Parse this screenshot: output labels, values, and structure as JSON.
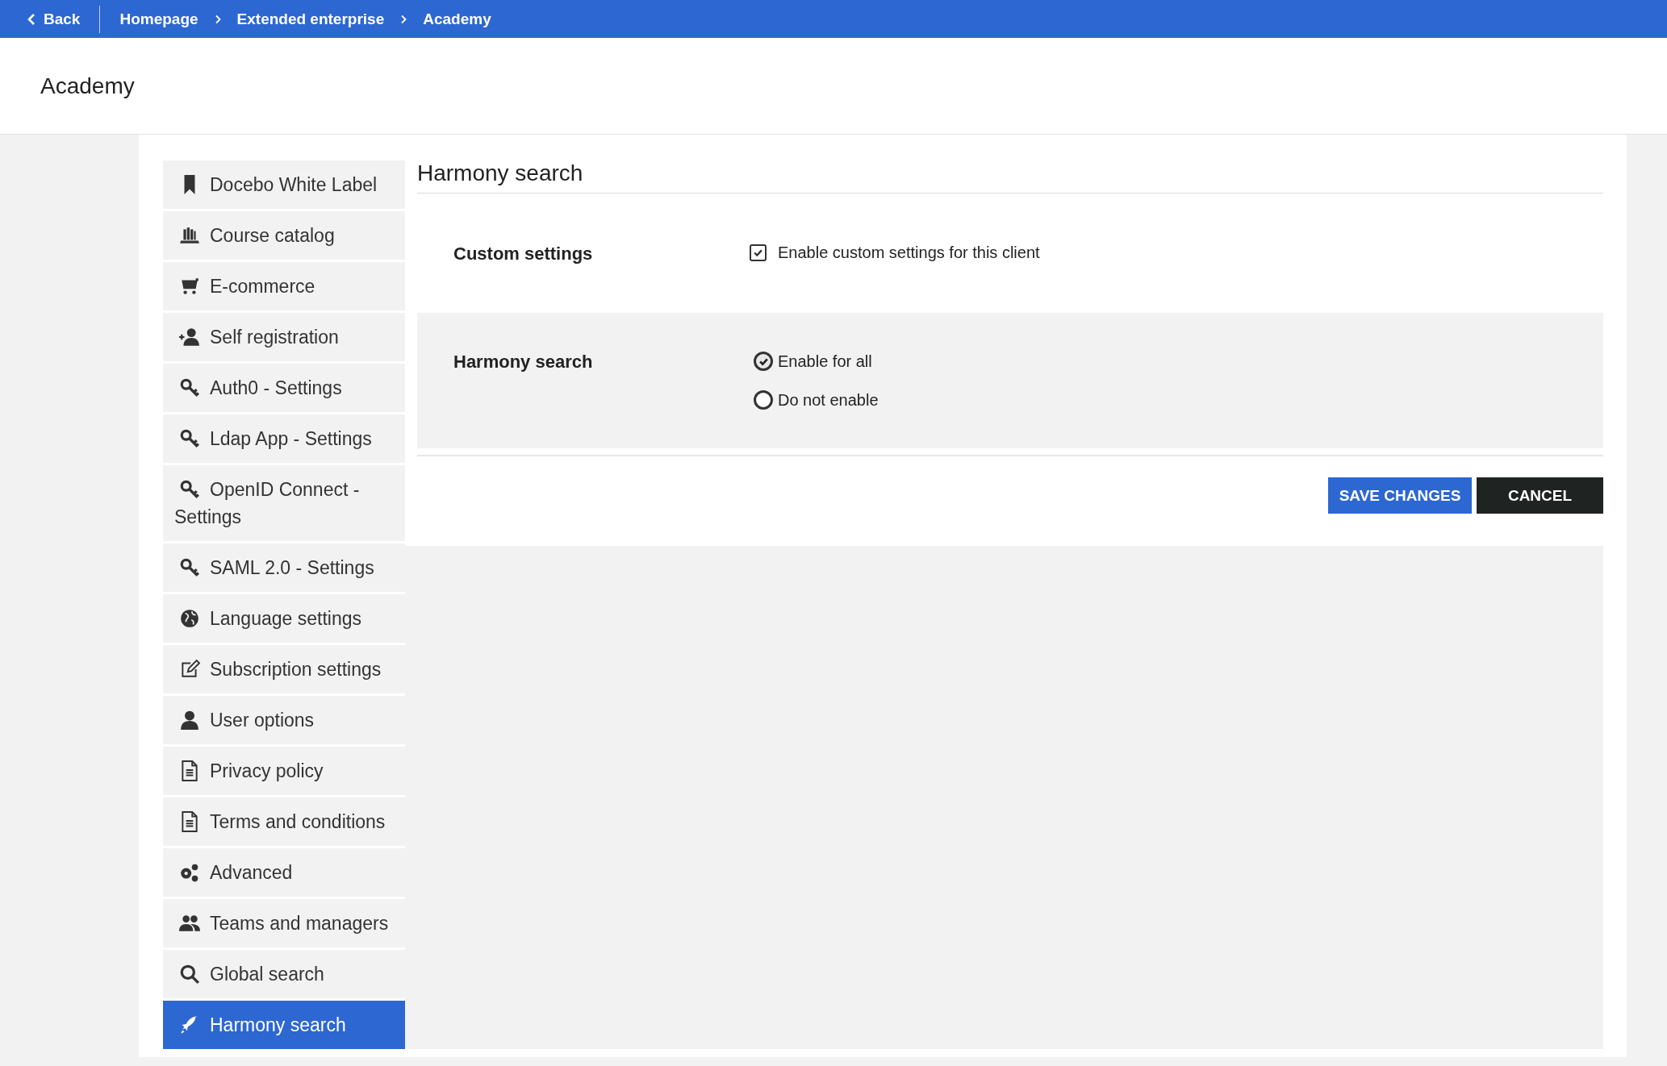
{
  "breadcrumb": {
    "back": "Back",
    "items": [
      "Homepage",
      "Extended enterprise",
      "Academy"
    ]
  },
  "page_title": "Academy",
  "sidebar": {
    "items": [
      {
        "label": "Docebo White Label",
        "selected": false
      },
      {
        "label": "Course catalog",
        "selected": false
      },
      {
        "label": "E-commerce",
        "selected": false
      },
      {
        "label": "Self registration",
        "selected": false
      },
      {
        "label": "Auth0 - Settings",
        "selected": false
      },
      {
        "label": "Ldap App - Settings",
        "selected": false
      },
      {
        "label": "OpenID Connect - Settings",
        "selected": false
      },
      {
        "label": "SAML 2.0 - Settings",
        "selected": false
      },
      {
        "label": "Language settings",
        "selected": false
      },
      {
        "label": "Subscription settings",
        "selected": false
      },
      {
        "label": "User options",
        "selected": false
      },
      {
        "label": "Privacy policy",
        "selected": false
      },
      {
        "label": "Terms and conditions",
        "selected": false
      },
      {
        "label": "Advanced",
        "selected": false
      },
      {
        "label": "Teams and managers",
        "selected": false
      },
      {
        "label": "Global search",
        "selected": false
      },
      {
        "label": "Harmony search",
        "selected": true
      }
    ]
  },
  "content": {
    "title": "Harmony search",
    "custom_settings": {
      "label": "Custom settings",
      "checkbox": {
        "label": "Enable custom settings for this client",
        "checked": true
      }
    },
    "harmony": {
      "label": "Harmony search",
      "options": [
        {
          "label": "Enable for all",
          "selected": true
        },
        {
          "label": "Do not enable",
          "selected": false
        }
      ]
    },
    "buttons": [
      {
        "label": "SAVE CHANGES",
        "kind": "primary"
      },
      {
        "label": "CANCEL",
        "kind": "secondary"
      }
    ]
  }
}
